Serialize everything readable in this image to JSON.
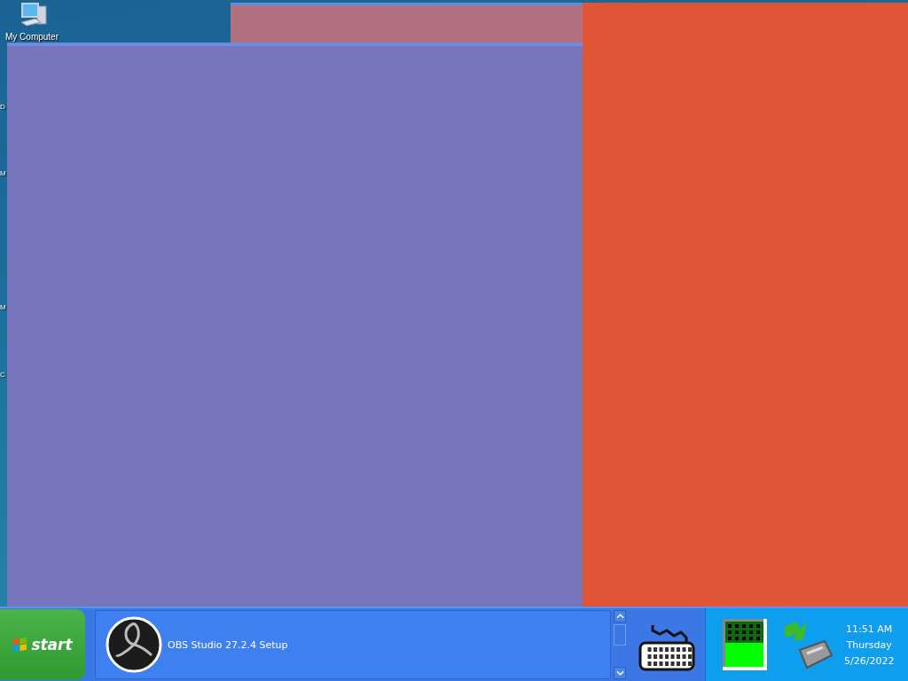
{
  "desktop": {
    "icons": [
      {
        "label": "My Computer"
      },
      {
        "label": "D"
      },
      {
        "label": "M"
      },
      {
        "label": "M"
      },
      {
        "label": "C"
      }
    ]
  },
  "taskbar": {
    "start_label": "start",
    "tasks": [
      {
        "label": "OBS Studio 27.2.4 Setup"
      }
    ],
    "clock": {
      "time": "11:51 AM",
      "day": "Thursday",
      "date": "5/26/2022"
    }
  }
}
